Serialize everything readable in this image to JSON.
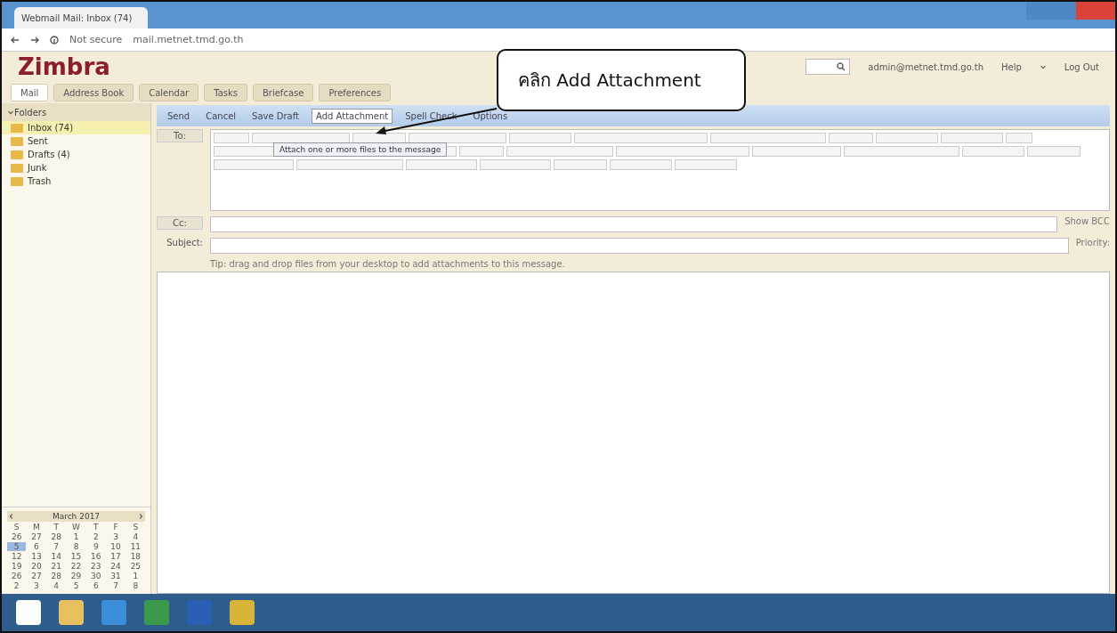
{
  "browser": {
    "tab_title": "Webmail Mail: Inbox (74)",
    "security": "Not secure",
    "url": "mail.metnet.tmd.go.th"
  },
  "header": {
    "logo": "Zimbra",
    "user": "admin@metnet.tmd.go.th",
    "help": "Help",
    "logout": "Log Out"
  },
  "app_tabs": [
    {
      "label": "Mail",
      "selected": true
    },
    {
      "label": "Address Book",
      "selected": false
    },
    {
      "label": "Calendar",
      "selected": false
    },
    {
      "label": "Tasks",
      "selected": false
    },
    {
      "label": "Briefcase",
      "selected": false
    },
    {
      "label": "Preferences",
      "selected": false
    }
  ],
  "folders": {
    "title": "Folders",
    "items": [
      {
        "label": "Inbox (74)",
        "selected": true
      },
      {
        "label": "Sent",
        "selected": false
      },
      {
        "label": "Drafts (4)",
        "selected": false
      },
      {
        "label": "Junk",
        "selected": false
      },
      {
        "label": "Trash",
        "selected": false
      }
    ]
  },
  "calendar": {
    "month": "March 2017",
    "weekdays": [
      "S",
      "M",
      "T",
      "W",
      "T",
      "F",
      "S"
    ],
    "weeks": [
      [
        {
          "day": "26",
          "selected": false
        },
        {
          "day": "27",
          "selected": false
        },
        {
          "day": "28",
          "selected": false
        },
        {
          "day": "1",
          "selected": false
        },
        {
          "day": "2",
          "selected": false
        },
        {
          "day": "3",
          "selected": false
        },
        {
          "day": "4",
          "selected": false
        }
      ],
      [
        {
          "day": "5",
          "selected": true
        },
        {
          "day": "6",
          "selected": false
        },
        {
          "day": "7",
          "selected": false
        },
        {
          "day": "8",
          "selected": false
        },
        {
          "day": "9",
          "selected": false
        },
        {
          "day": "10",
          "selected": false
        },
        {
          "day": "11",
          "selected": false
        }
      ],
      [
        {
          "day": "12",
          "selected": false
        },
        {
          "day": "13",
          "selected": false
        },
        {
          "day": "14",
          "selected": false
        },
        {
          "day": "15",
          "selected": false
        },
        {
          "day": "16",
          "selected": false
        },
        {
          "day": "17",
          "selected": false
        },
        {
          "day": "18",
          "selected": false
        }
      ],
      [
        {
          "day": "19",
          "selected": false
        },
        {
          "day": "20",
          "selected": false
        },
        {
          "day": "21",
          "selected": false
        },
        {
          "day": "22",
          "selected": false
        },
        {
          "day": "23",
          "selected": false
        },
        {
          "day": "24",
          "selected": false
        },
        {
          "day": "25",
          "selected": false
        }
      ],
      [
        {
          "day": "26",
          "selected": false
        },
        {
          "day": "27",
          "selected": false
        },
        {
          "day": "28",
          "selected": false
        },
        {
          "day": "29",
          "selected": false
        },
        {
          "day": "30",
          "selected": false
        },
        {
          "day": "31",
          "selected": false
        },
        {
          "day": "1",
          "selected": false
        }
      ],
      [
        {
          "day": "2",
          "selected": false
        },
        {
          "day": "3",
          "selected": false
        },
        {
          "day": "4",
          "selected": false
        },
        {
          "day": "5",
          "selected": false
        },
        {
          "day": "6",
          "selected": false
        },
        {
          "day": "7",
          "selected": false
        },
        {
          "day": "8",
          "selected": false
        }
      ]
    ]
  },
  "compose_toolbar": [
    "Send",
    "Cancel",
    "Save Draft",
    "Add Attachment",
    "Spell Check",
    "Options"
  ],
  "tooltip": "Attach one or more files to the message",
  "compose": {
    "to_label": "To:",
    "cc_label": "Cc:",
    "show_bcc": "Show BCC",
    "subject_label": "Subject:",
    "priority_label": "Priority:",
    "tip": "Tip: drag and drop files from your desktop to add attachments to this message."
  },
  "callout": "คลิก Add Attachment"
}
